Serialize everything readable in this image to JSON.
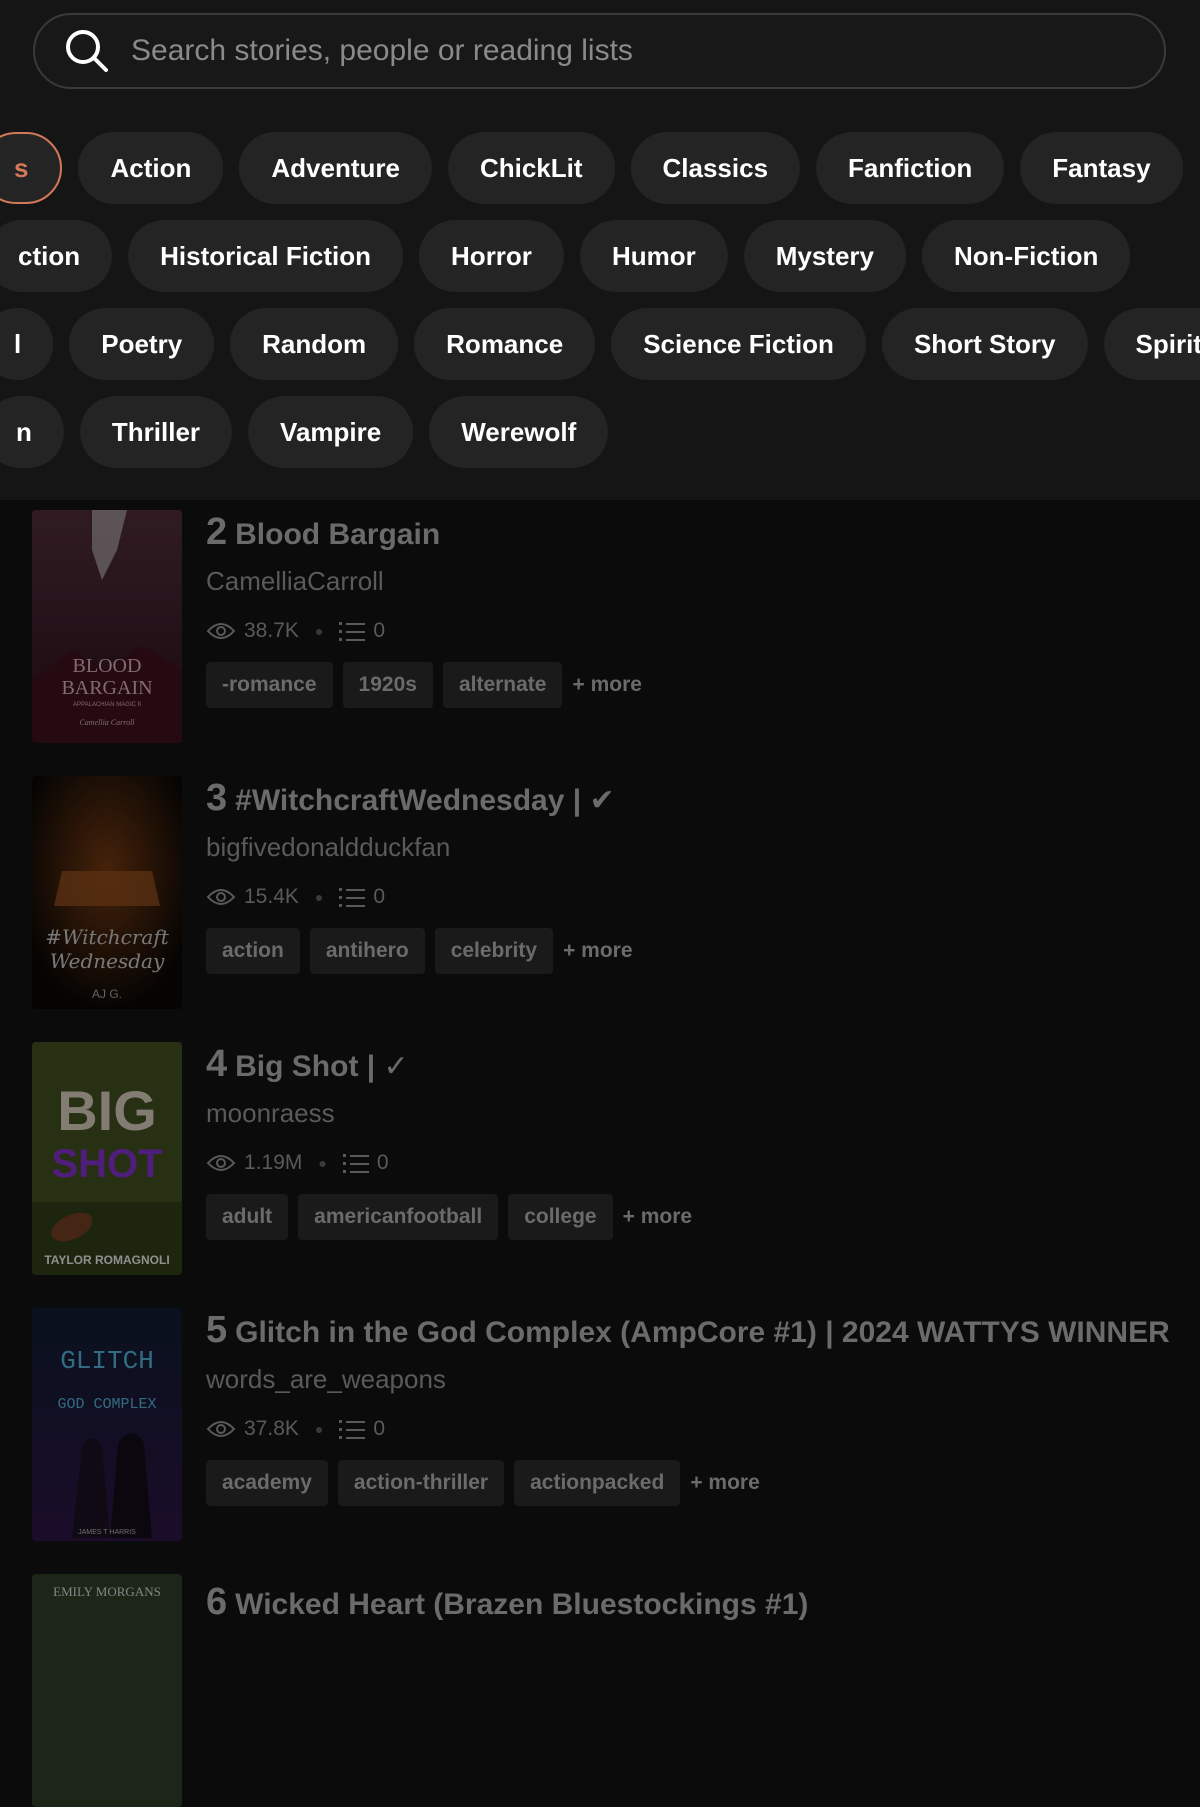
{
  "search": {
    "placeholder": "Search stories, people or reading lists"
  },
  "genres": {
    "row1": [
      "s",
      "Action",
      "Adventure",
      "ChickLit",
      "Classics",
      "Fanfiction",
      "Fantasy"
    ],
    "row2": [
      "ction",
      "Historical Fiction",
      "Horror",
      "Humor",
      "Mystery",
      "Non-Fiction"
    ],
    "row3": [
      "l",
      "Poetry",
      "Random",
      "Romance",
      "Science Fiction",
      "Short Story",
      "Spiritu"
    ],
    "row4": [
      "n",
      "Thriller",
      "Vampire",
      "Werewolf"
    ]
  },
  "stories": [
    {
      "rank": "2",
      "title": "Blood Bargain",
      "author": "CamelliaCarroll",
      "reads": "38.7K",
      "lists": "0",
      "tags": [
        "-romance",
        "1920s",
        "alternate"
      ],
      "more": "+ more",
      "cover_text": [
        "BLOOD",
        "BARGAIN",
        "APPALACHIAN MAGIC II",
        "Camellia Carroll"
      ]
    },
    {
      "rank": "3",
      "title": "#WitchcraftWednesday | ✔",
      "author": "bigfivedonaldduckfan",
      "reads": "15.4K",
      "lists": "0",
      "tags": [
        "action",
        "antihero",
        "celebrity"
      ],
      "more": "+ more",
      "cover_text": [
        "#Witchcraft",
        "Wednesday",
        "AJ G."
      ]
    },
    {
      "rank": "4",
      "title": "Big Shot | ✓",
      "author": "moonraess",
      "reads": "1.19M",
      "lists": "0",
      "tags": [
        "adult",
        "americanfootball",
        "college"
      ],
      "more": "+ more",
      "cover_text": [
        "BIG",
        "SHOT",
        "TAYLOR ROMAGNOLI"
      ]
    },
    {
      "rank": "5",
      "title": "Glitch in the God Complex (AmpCore #1) | 2024 WATTYS WINNER",
      "author": "words_are_weapons",
      "reads": "37.8K",
      "lists": "0",
      "tags": [
        "academy",
        "action-thriller",
        "actionpacked"
      ],
      "more": "+ more",
      "cover_text": [
        "GLITCH",
        "GOD COMPLEX",
        "JAMES T HARRIS"
      ]
    },
    {
      "rank": "6",
      "title": "Wicked Heart (Brazen Bluestockings #1)",
      "author": "",
      "cover_text": [
        "EMILY MORGANS"
      ]
    }
  ]
}
